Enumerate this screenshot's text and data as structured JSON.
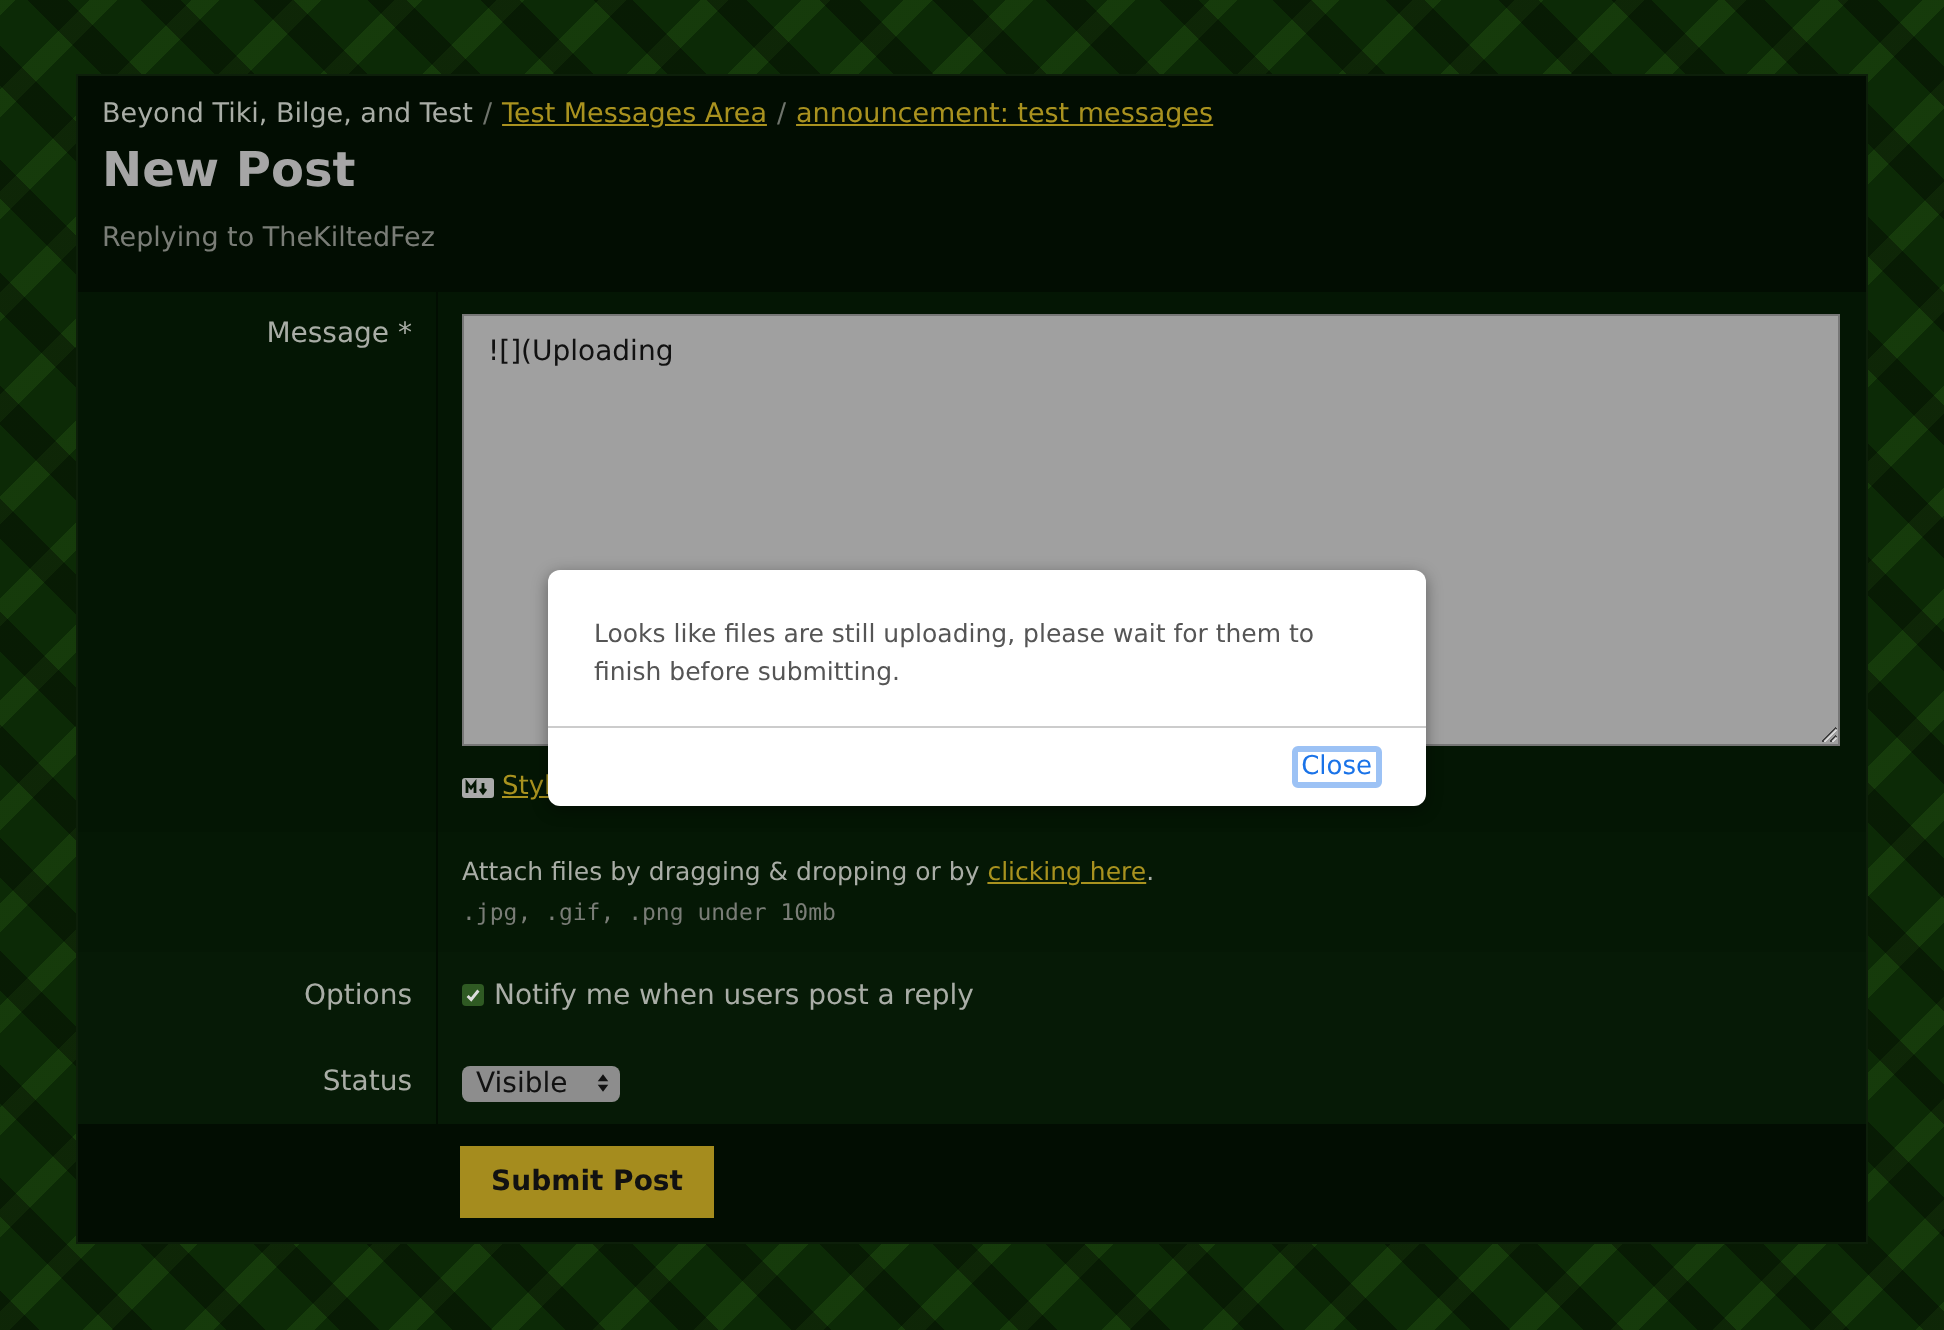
{
  "breadcrumb": {
    "root": "Beyond Tiki, Bilge, and Test",
    "separator": "/",
    "links": [
      "Test Messages Area ",
      "announcement: test messages"
    ]
  },
  "title": "New Post",
  "subtitle": "Replying to TheKiltedFez",
  "message": {
    "label": "Message *",
    "value": "![](Uploading",
    "styling_link": "Styl"
  },
  "attach": {
    "text": "Attach files by dragging & dropping or by ",
    "link": "clicking here",
    "after": ".",
    "hint": ".jpg, .gif, .png under 10mb"
  },
  "options": {
    "label": "Options",
    "notify": {
      "label": "Notify me when users post a reply",
      "checked": true
    }
  },
  "status": {
    "label": "Status",
    "value": "Visible"
  },
  "submit": "Submit Post",
  "dialog": {
    "message": "Looks like files are still uploading, please wait for them to finish before submitting.",
    "button": "Close"
  }
}
